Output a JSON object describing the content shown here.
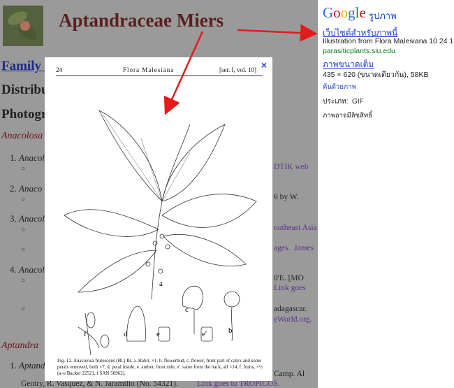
{
  "page": {
    "title": "Aptandraceae Miers",
    "family_link": "Family I",
    "h_distribution": "Distribu",
    "h_photos": "Photogr",
    "genus1": "Anacolosa",
    "genus2": "Aptandra",
    "list": [
      {
        "num": "1.",
        "text": "Anacol"
      },
      {
        "num": "2.",
        "text": "Anaco"
      },
      {
        "num": "3.",
        "text": "Anacol"
      },
      {
        "num": "4.",
        "text": "Anacol"
      },
      {
        "num": "1.",
        "text": "Aptand"
      }
    ],
    "fragments": {
      "f1": "DTIK web",
      "f2": "6 by W.",
      "f3": "outheast Asia",
      "f4": "ages.",
      "f5": "James",
      "f6": "0'E. [MO",
      "f7": "Link goes",
      "f8": "adagascar.",
      "f9": "eWorld.org.",
      "f10": "Camp. Al",
      "f11": "Gentry, R. Vasquez, & N. Jaramillo (No. 54321).",
      "f12": "Link goes to TROPICOS."
    }
  },
  "overlay": {
    "close": "×",
    "page_num": "24",
    "running_head": "Flora Malesiana",
    "series": "[ser. I, vol. 10]",
    "labels": {
      "a": "a",
      "b": "b",
      "c": "c",
      "d": "d",
      "e": "e",
      "e2": "e'",
      "f": "f"
    },
    "caption": "Fig. 12. Anacolosa frutescens (Bl.) Bl. a. Habit, ×1, b. flowerbud, c. flower, front part of calyx and some petals removed, both ×7, d. petal inside, e. anther, front side, e'. same from the back, all ×14, f. fruits, ×½ (a–e Backer 22521, f SAN 50962)."
  },
  "panel": {
    "logo": "Google",
    "logo_sub": "รูปภาพ",
    "website_link": "เว็บไซต์สำหรับภาพนี้",
    "description": "Illustration from Flora Malesiana 10 24 1984.",
    "source_url": "parasiticplants.siu.edu",
    "full_size_link": "ภาพขนาดเต็ม",
    "size_info": "435 × 620 (ขนาดเดียวกัน), 58KB",
    "similar": "ค้นด้วยภาพ",
    "type_label": "ประเภท:",
    "type_value": "GIF",
    "rights": "ภาพอาจมีลิขสิทธิ์"
  },
  "colors": {
    "arrow": "#e31b1b",
    "link": "#1a3fcc",
    "url_green": "#0a7a22"
  }
}
